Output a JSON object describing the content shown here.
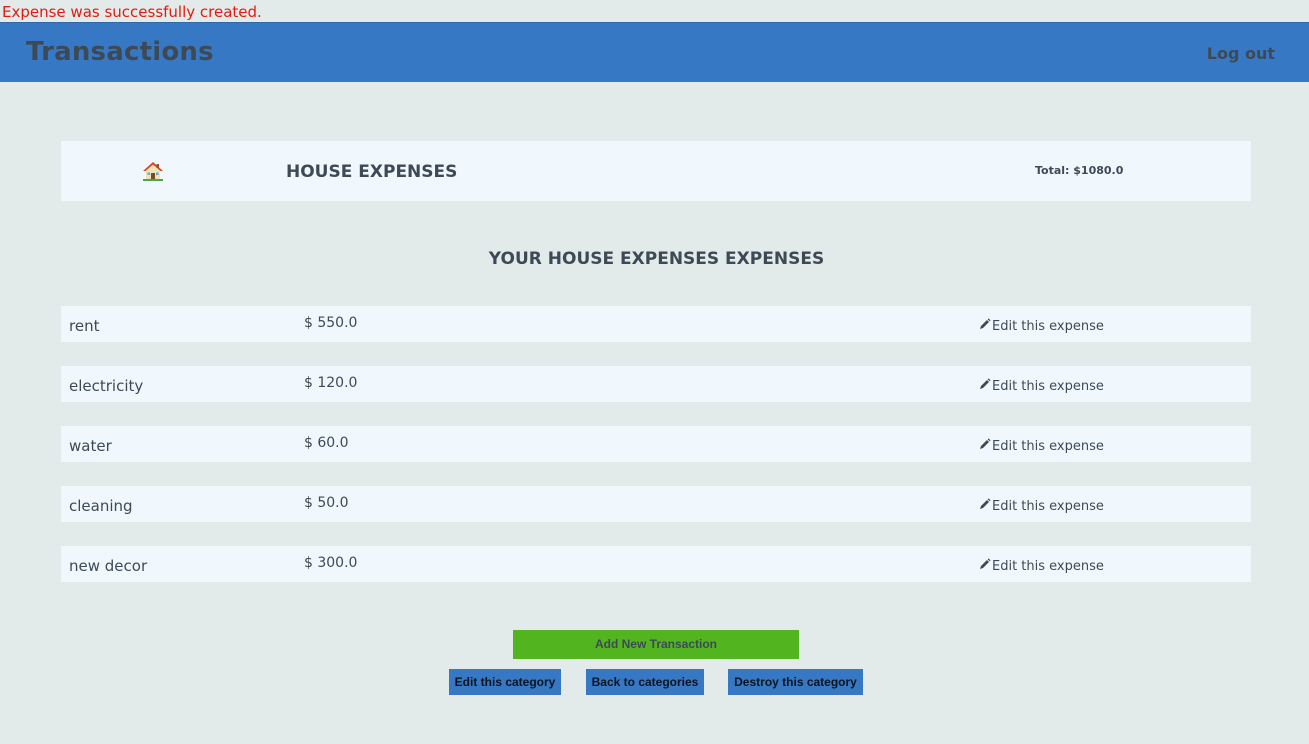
{
  "notice": "Expense was successfully created.",
  "header": {
    "title": "Transactions",
    "logout_label": "Log out"
  },
  "category": {
    "icon": "house-icon",
    "name": "HOUSE EXPENSES",
    "total": "Total: $1080.0"
  },
  "section_title": "YOUR HOUSE EXPENSES EXPENSES",
  "expenses": [
    {
      "name": "rent",
      "amount": "$ 550.0",
      "edit_label": "Edit this expense"
    },
    {
      "name": "electricity",
      "amount": "$ 120.0",
      "edit_label": "Edit this expense"
    },
    {
      "name": "water",
      "amount": "$ 60.0",
      "edit_label": "Edit this expense"
    },
    {
      "name": "cleaning",
      "amount": "$ 50.0",
      "edit_label": "Edit this expense"
    },
    {
      "name": "new decor",
      "amount": "$ 300.0",
      "edit_label": "Edit this expense"
    }
  ],
  "actions": {
    "add_label": "Add New Transaction",
    "edit_category_label": "Edit this category",
    "back_label": "Back to categories",
    "destroy_label": "Destroy this category"
  },
  "colors": {
    "header_bg": "#3778c4",
    "page_bg": "#e3ebea",
    "card_bg": "#f0f8fe",
    "add_button_bg": "#52b520",
    "notice_text": "#e31b0e"
  }
}
